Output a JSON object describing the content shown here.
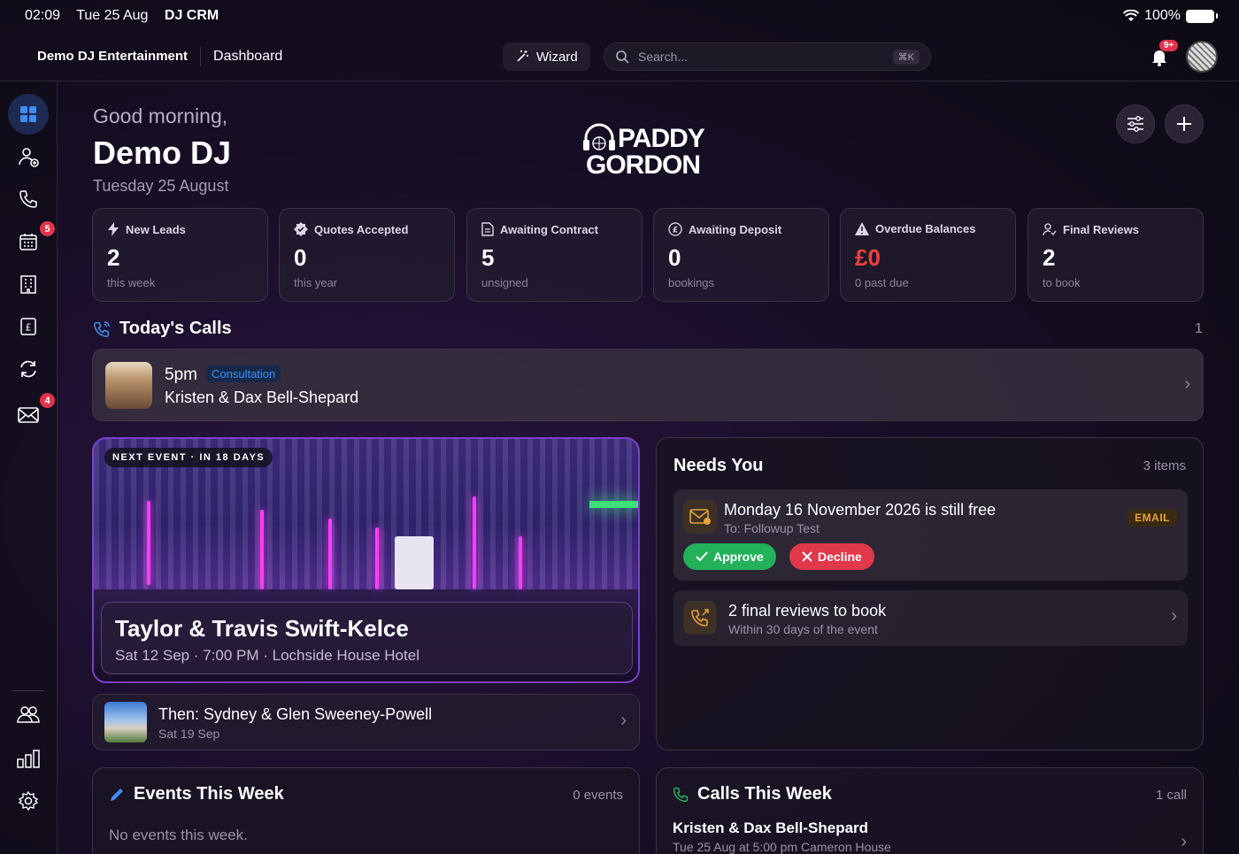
{
  "status_bar": {
    "time": "02:09",
    "date": "Tue 25 Aug",
    "app": "DJ CRM",
    "battery": "100%"
  },
  "topnav": {
    "brand": "Demo DJ Entertainment",
    "crumb": "Dashboard",
    "wizard_label": "Wizard",
    "search_placeholder": "Search...",
    "search_shortcut": "⌘K",
    "notification_badge": "9+"
  },
  "sidebar": {
    "items": [
      {
        "name": "dashboard",
        "icon": "grid-icon",
        "active": true
      },
      {
        "name": "leads",
        "icon": "add-user-icon"
      },
      {
        "name": "calls",
        "icon": "phone-icon"
      },
      {
        "name": "calendar",
        "icon": "calendar-icon",
        "badge": "5"
      },
      {
        "name": "venues",
        "icon": "building-icon"
      },
      {
        "name": "finance",
        "icon": "pound-receipt-icon"
      },
      {
        "name": "sync",
        "icon": "refresh-icon"
      },
      {
        "name": "mail",
        "icon": "mail-icon",
        "badge": "4"
      },
      {
        "name": "team",
        "icon": "users-icon"
      },
      {
        "name": "reports",
        "icon": "bar-chart-icon"
      },
      {
        "name": "settings",
        "icon": "gear-icon"
      }
    ]
  },
  "header": {
    "greeting": "Good morning,",
    "name": "Demo DJ",
    "date": "Tuesday 25 August",
    "logo_line1": "PADDY",
    "logo_line2": "GORDON"
  },
  "stats": [
    {
      "label": "New Leads",
      "value": "2",
      "sub": "this week",
      "icon": "bolt-icon",
      "color": "#ffffff"
    },
    {
      "label": "Quotes Accepted",
      "value": "0",
      "sub": "this year",
      "icon": "check-badge-icon",
      "color": "#ffffff"
    },
    {
      "label": "Awaiting Contract",
      "value": "5",
      "sub": "unsigned",
      "icon": "document-icon",
      "color": "#ffffff"
    },
    {
      "label": "Awaiting Deposit",
      "value": "0",
      "sub": "bookings",
      "icon": "pound-circle-icon",
      "color": "#ffffff"
    },
    {
      "label": "Overdue Balances",
      "value": "£0",
      "sub": "0 past due",
      "icon": "warning-icon",
      "color": "#f0413c"
    },
    {
      "label": "Final Reviews",
      "value": "2",
      "sub": "to book",
      "icon": "review-icon",
      "color": "#ffffff"
    }
  ],
  "todays_calls": {
    "title": "Today's Calls",
    "count": "1",
    "call": {
      "time": "5pm",
      "tag": "Consultation",
      "name": "Kristen & Dax Bell-Shepard"
    }
  },
  "next_event": {
    "chip": "NEXT EVENT · IN 18 DAYS",
    "title": "Taylor & Travis Swift-Kelce",
    "details": "Sat 12 Sep · 7:00 PM · Lochside House Hotel"
  },
  "then_event": {
    "title": "Then: Sydney & Glen Sweeney-Powell",
    "date": "Sat 19 Sep"
  },
  "needs_you": {
    "title": "Needs You",
    "count": "3 items",
    "item1": {
      "title": "Monday 16 November 2026 is still free",
      "sub": "To: Followup Test",
      "tag": "EMAIL",
      "approve": "Approve",
      "decline": "Decline"
    },
    "item2": {
      "title": "2 final reviews to book",
      "sub": "Within 30 days of the event"
    }
  },
  "events_week": {
    "title": "Events This Week",
    "count": "0 events",
    "empty": "No events this week."
  },
  "calls_week": {
    "title": "Calls This Week",
    "count": "1 call",
    "name": "Kristen & Dax Bell-Shepard",
    "sub": "Tue 25 Aug  at 5:00 pm  Cameron House"
  },
  "colors": {
    "accent": "#3d8ef0",
    "danger": "#e0394a",
    "success": "#23b15a",
    "warning": "#e6a23c"
  }
}
